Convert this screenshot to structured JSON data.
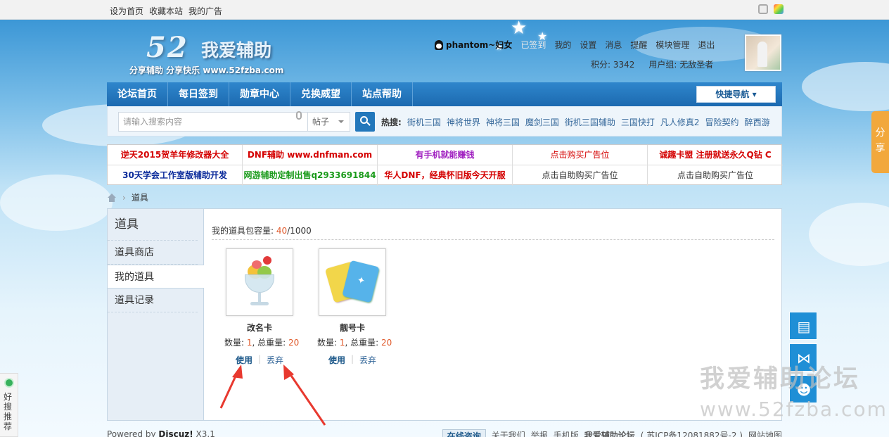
{
  "topbar": {
    "links": [
      "设为首页",
      "收藏本站",
      "我的广告"
    ],
    "icons": [
      "fullscreen-icon",
      "color-scheme-icon"
    ]
  },
  "logo": {
    "number": "52",
    "name": "我爱辅助",
    "tagline": "分享辅助   分享快乐   www.52fzba.com"
  },
  "user": {
    "qq_icon": "qq-penguin-icon",
    "username": "phantom~妇女",
    "signed": "已签到",
    "menu": [
      "我的",
      "设置",
      "消息",
      "提醒",
      "模块管理",
      "退出"
    ],
    "points": "积分: 3342",
    "group": "用户组: 无敌圣者"
  },
  "nav": {
    "items": [
      "论坛首页",
      "每日签到",
      "勋章中心",
      "兑换威望",
      "站点帮助"
    ],
    "quick": "快捷导航"
  },
  "search": {
    "placeholder": "请输入搜索内容",
    "type": "帖子",
    "hot_label": "热搜:",
    "hot": [
      "街机三国",
      "神将世界",
      "神将三国",
      "魔剑三国",
      "街机三国辅助",
      "三国快打",
      "凡人修真2",
      "冒险契约",
      "醉西游"
    ]
  },
  "ads": [
    [
      {
        "t": "逆天2015贺羊年修改器大全",
        "c": "#d40000",
        "b": true
      },
      {
        "t": "DNF辅助 www.dnfman.com",
        "c": "#d40000",
        "b": true
      },
      {
        "t": "有手机就能赚钱",
        "c": "#a020c0",
        "b": true
      },
      {
        "t": "点击购买广告位",
        "c": "#d40000",
        "b": false
      },
      {
        "t": "诚趣卡盟 注册就送永久Q钻 C",
        "c": "#d40000",
        "b": true
      }
    ],
    [
      {
        "t": "30天学会工作室版辅助开发",
        "c": "#0a2a9a",
        "b": true
      },
      {
        "t": "网游辅助定制出售q2933691844",
        "c": "#1a9a1a",
        "b": true
      },
      {
        "t": "华人DNF，经典怀旧版今天开服",
        "c": "#d40000",
        "b": true
      },
      {
        "t": "点击自助购买广告位",
        "c": "#333333",
        "b": false
      },
      {
        "t": "点击自助购买广告位",
        "c": "#333333",
        "b": false
      }
    ]
  ],
  "breadcrumb": {
    "current": "道具"
  },
  "side": {
    "title": "道具",
    "items": [
      "道具商店",
      "我的道具",
      "道具记录"
    ],
    "active": 1
  },
  "main": {
    "capacity_label": "我的道具包容量: ",
    "capacity_used": "40",
    "capacity_total": "/1000",
    "items": [
      {
        "name": "改名卡",
        "qty_label": "数量: ",
        "qty": "1",
        "weight_label": ", 总重量: ",
        "weight": "20",
        "use": "使用",
        "drop": "丢弃",
        "icon": "sundae-icon"
      },
      {
        "name": "靓号卡",
        "qty_label": "数量: ",
        "qty": "1",
        "weight_label": ", 总重量: ",
        "weight": "20",
        "use": "使用",
        "drop": "丢弃",
        "icon": "cards-icon"
      }
    ]
  },
  "footer": {
    "powered": "Powered by ",
    "brand": "Discuz!",
    "version": " X3.1",
    "online": "在线咨询",
    "links": [
      "关于我们",
      "举报",
      "手机版",
      "我爱辅助论坛",
      "( 苏ICP备12081882号-2 )",
      "网站地图"
    ]
  },
  "float": {
    "share": "分享",
    "buttons": [
      "notes-icon",
      "share-nodes-icon",
      "user-icon"
    ],
    "left": "好搜推荐"
  },
  "watermark": {
    "line1": "我爱辅助论坛",
    "line2": "www.52fzba.com"
  }
}
